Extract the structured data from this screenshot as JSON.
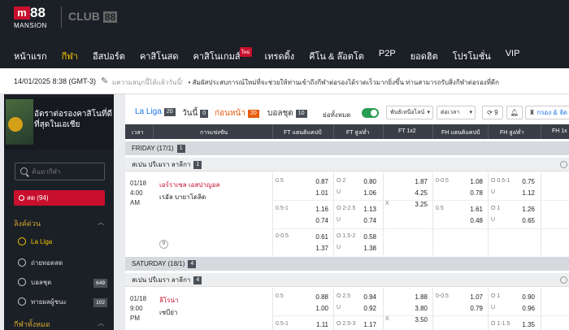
{
  "brand": {
    "logo_letter": "m",
    "logo_number": "88",
    "logo_sub": "MANSION",
    "club_text": "CLUB",
    "club_num": "88"
  },
  "nav": [
    {
      "label": "หน้าแรก",
      "active": false
    },
    {
      "label": "กีฬา",
      "active": true
    },
    {
      "label": "อีสปอร์ต",
      "active": false
    },
    {
      "label": "คาสิโนสด",
      "active": false
    },
    {
      "label": "คาสิโนเกมส์",
      "active": false,
      "badge": "ใหม่"
    },
    {
      "label": "เทรดดิ้ง",
      "active": false
    },
    {
      "label": "คีโน & ล๊อตโต",
      "active": false
    },
    {
      "label": "P2P",
      "active": false
    },
    {
      "label": "ยอดฮิต",
      "active": false
    },
    {
      "label": "โปรโมชั่น",
      "active": false
    },
    {
      "label": "VIP",
      "active": false
    }
  ],
  "infobar": {
    "datetime": "14/01/2025 8:38 (GMT-3)",
    "ticker_a": "ิมความสนุกนี้ได้แล้ววันนี้!",
    "ticker_b": "•  สัมผัสประสบการณ์ใหม่ที่จะช่วยให้ท่านเข้าถึงกีฬาต่อรองได้รวดเร็วมากยิ่งขึ้น ท่านสามารถรับสิ่งกีฬาต่อรองที่ดีก"
  },
  "sidebar": {
    "promo_text": "อัตราต่อรองคาสิโนที่ดีที่สุดในเอเชีย",
    "search_placeholder": "ค้นหากีฬา",
    "live_label": "สด (94)",
    "quicklinks_title": "ลิงค์ด่วน",
    "items": [
      {
        "label": "La Liga",
        "count": "",
        "highlight": true
      },
      {
        "label": "ถ่ายทอดสด",
        "count": "",
        "highlight": false
      },
      {
        "label": "บอลชุด",
        "count": "649",
        "highlight": false
      },
      {
        "label": "ทายผลผู้ชนะ",
        "count": "102",
        "highlight": false
      }
    ],
    "all_sports_title": "กีฬาทั้งหมด"
  },
  "tabs": [
    {
      "label": "La Liga",
      "count": "20",
      "style": "liga"
    },
    {
      "label": "วันนี้",
      "count": "0",
      "style": ""
    },
    {
      "label": "ก่อนหน้า",
      "count": "20",
      "style": "active"
    },
    {
      "label": "บอลชุด",
      "count": "10",
      "style": ""
    }
  ],
  "controls": {
    "show_all_label": "ย่อทั้งหมด",
    "odds_type": "พันธ์เหนือไลน์",
    "sort": "ต่อเวลา",
    "refresh_count": "9",
    "filter_label": "กรอง & จัด"
  },
  "columns": [
    "เวลา",
    "การแข่งขัน",
    "FT แฮนดิแคปป์",
    "FT สูง/ต่ำ",
    "FT 1x2",
    "FH แฮนดิแคปป์",
    "FH สูง/ต่ำ",
    "FH 1x"
  ],
  "days": [
    {
      "label": "FRIDAY (17/1)",
      "count": "1"
    },
    {
      "label": "SATURDAY (18/1)",
      "count": "4"
    }
  ],
  "leagues": [
    {
      "label": "สเปน ปรีเมรา ลาลีกา",
      "count": "1"
    },
    {
      "label": "สเปน ปรีเมรา ลาลีกา",
      "count": "4"
    }
  ],
  "matches": [
    {
      "date": "01/18",
      "time": "4:00",
      "ampm": "AM",
      "home": "เอร์ราเซล เอสปาญอล",
      "away": "เรอัล บายาโดลิด",
      "more": "9",
      "rows": [
        {
          "hdp_line": "0.5",
          "hdp_home": "0.87",
          "hdp_away": "1.01",
          "ou_o": "O 2",
          "ou_over": "0.80",
          "ou_u": "U",
          "ou_under": "1.06",
          "x1": "1.87",
          "x2": "4.25",
          "xx": "X",
          "x3": "3.25",
          "fh_line": "0-0.5",
          "fh_home": "1.08",
          "fh_away": "0.78",
          "fho_o": "O 0.5-1",
          "fho_over": "0.75",
          "fho_u": "U",
          "fho_under": "1.12"
        },
        {
          "hdp_line": "0.5-1",
          "hdp_home": "1.16",
          "hdp_away": "0.74",
          "ou_o": "O 2-2.5",
          "ou_over": "1.13",
          "ou_u": "U",
          "ou_under": "0.74",
          "fh_line": "0.5",
          "fh_home": "1.61",
          "fh_away": "0.48",
          "fho_o": "O 1",
          "fho_over": "1.26",
          "fho_u": "U",
          "fho_under": "0.65"
        },
        {
          "hdp_line": "0-0.5",
          "hdp_home": "0.61",
          "hdp_away": "1.37",
          "ou_o": "O 1.5-2",
          "ou_over": "0.58",
          "ou_u": "U",
          "ou_under": "1.38"
        }
      ]
    },
    {
      "date": "01/18",
      "time": "9:00",
      "ampm": "PM",
      "home": "ลีโรน่า",
      "away": "เซบีย่า",
      "rows": [
        {
          "hdp_line": "0.5",
          "hdp_home": "0.88",
          "hdp_away": "1.00",
          "ou_o": "O 2.5",
          "ou_over": "0.94",
          "ou_u": "U",
          "ou_under": "0.92",
          "x1": "1.88",
          "x2": "3.80",
          "xx": "X",
          "x3": "3.50",
          "fh_line": "0-0.5",
          "fh_home": "1.07",
          "fh_away": "0.79",
          "fho_o": "O 1",
          "fho_over": "0.90",
          "fho_u": "U",
          "fho_under": "0.96"
        },
        {
          "hdp_line": "0.5-1",
          "hdp_home": "1.11",
          "ou_o": "O 2.5-3",
          "ou_over": "1.17",
          "fho_o": "O 1-1.5",
          "fho_over": "1.35"
        }
      ]
    }
  ]
}
